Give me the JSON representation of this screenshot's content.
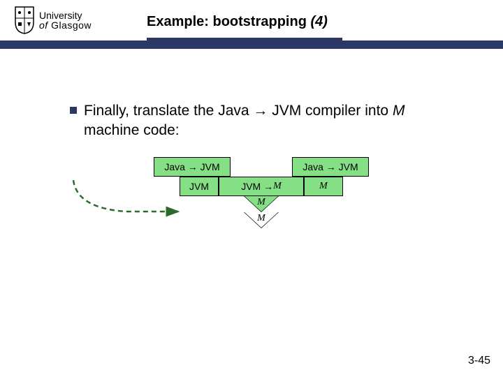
{
  "logo": {
    "line1": "University",
    "line2": "of Glasgow"
  },
  "title": {
    "prefix": "Example: bootstrapping ",
    "suffix": "(4)"
  },
  "bullet": {
    "pre": "Finally, translate the Java → JVM compiler into ",
    "m": "M",
    "post": " machine code:"
  },
  "boxes": {
    "top_left": "Java → JVM",
    "top_right": "Java → JVM",
    "bot_left": "JVM",
    "bot_mid_pre": "JVM → ",
    "bot_mid_m": "M",
    "bot_right": "M",
    "tri_top": "M",
    "tri_bot": "M"
  },
  "pagenum": "3-45"
}
